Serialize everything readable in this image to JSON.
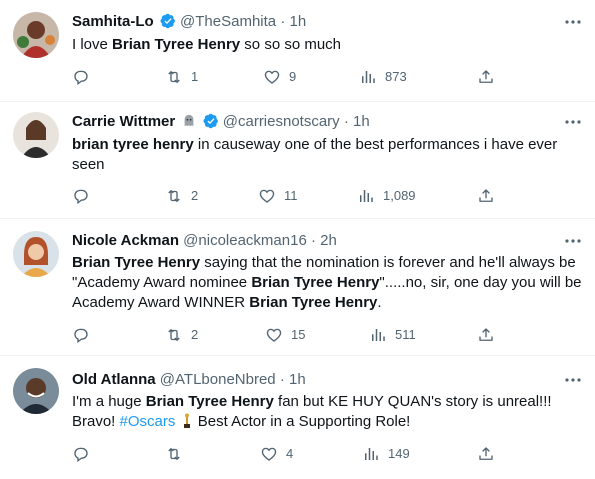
{
  "tweets": [
    {
      "name": "Samhita-Lo",
      "handle": "@TheSamhita",
      "time": "1h",
      "verified": true,
      "segments": [
        {
          "t": "I love ",
          "b": false
        },
        {
          "t": "Brian Tyree Henry",
          "b": true
        },
        {
          "t": " so so so much",
          "b": false
        }
      ],
      "replies": "",
      "retweets": "1",
      "likes": "9",
      "views": "873"
    },
    {
      "name": "Carrie Wittmer",
      "handle": "@carriesnotscary",
      "time": "1h",
      "verified": true,
      "emoji": "ghost-emoji",
      "segments": [
        {
          "t": "brian tyree henry",
          "b": true
        },
        {
          "t": " in causeway one of the best performances i have ever seen",
          "b": false
        }
      ],
      "replies": "",
      "retweets": "2",
      "likes": "11",
      "views": "1,089"
    },
    {
      "name": "Nicole Ackman",
      "handle": "@nicoleackman16",
      "time": "2h",
      "verified": false,
      "segments": [
        {
          "t": "Brian Tyree Henry",
          "b": true
        },
        {
          "t": " saying that the nomination is forever and he'll always be \"Academy Award nominee ",
          "b": false
        },
        {
          "t": "Brian Tyree Henry",
          "b": true
        },
        {
          "t": "\".....no, sir, one day you will be Academy Award WINNER ",
          "b": false
        },
        {
          "t": "Brian Tyree Henry",
          "b": true
        },
        {
          "t": ".",
          "b": false
        }
      ],
      "replies": "",
      "retweets": "2",
      "likes": "15",
      "views": "511"
    },
    {
      "name": "Old Atlanna",
      "handle": "@ATLboneNbred",
      "time": "1h",
      "verified": false,
      "segments": [
        {
          "t": "I'm a huge ",
          "b": false
        },
        {
          "t": "Brian Tyree Henry",
          "b": true
        },
        {
          "t": " fan but KE HUY QUAN's story is unreal!!! Bravo! ",
          "b": false
        },
        {
          "t": "#Oscars",
          "b": false,
          "tag": true
        },
        {
          "t": "TROPHY",
          "b": false,
          "trophy": true
        },
        {
          "t": " Best Actor in a Supporting Role!",
          "b": false
        }
      ],
      "replies": "",
      "retweets": "",
      "likes": "4",
      "views": "149"
    }
  ],
  "colors": {
    "text": "#0f1419",
    "secondary": "#536471",
    "accent": "#1d9bf0",
    "divider": "#eff3f4"
  },
  "icons": {
    "reply": "reply-icon",
    "retweet": "retweet-icon",
    "like": "like-icon",
    "views": "views-icon",
    "share": "share-icon",
    "more": "more-icon",
    "verified": "verified-badge-icon"
  },
  "separator": "·"
}
